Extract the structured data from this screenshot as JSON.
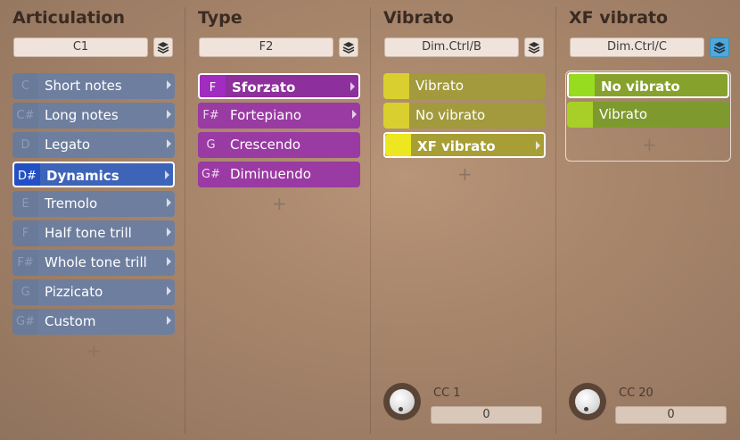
{
  "colors": {
    "articulation_selected": "#2250c4",
    "type_item": "#9a3aa3",
    "vibrato_item": "#d9cf2f",
    "xf_vibrato_item": "#97dc1e",
    "layers_active": "#4fa8d8"
  },
  "columns": {
    "articulation": {
      "title": "Articulation",
      "keyswitch": "C1",
      "layers_icon": "layers-icon",
      "items": [
        {
          "key": "C",
          "label": "Short notes"
        },
        {
          "key": "C#",
          "label": "Long notes"
        },
        {
          "key": "D",
          "label": "Legato"
        },
        {
          "key": "D#",
          "label": "Dynamics",
          "selected": true
        },
        {
          "key": "E",
          "label": "Tremolo"
        },
        {
          "key": "F",
          "label": "Half tone trill"
        },
        {
          "key": "F#",
          "label": "Whole tone trill"
        },
        {
          "key": "G",
          "label": "Pizzicato"
        },
        {
          "key": "G#",
          "label": "Custom"
        }
      ],
      "add_label": "+"
    },
    "type": {
      "title": "Type",
      "keyswitch": "F2",
      "layers_icon": "layers-icon",
      "items": [
        {
          "key": "F",
          "label": "Sforzato",
          "selected": true
        },
        {
          "key": "F#",
          "label": "Fortepiano"
        },
        {
          "key": "G",
          "label": "Crescendo"
        },
        {
          "key": "G#",
          "label": "Diminuendo"
        }
      ],
      "add_label": "+"
    },
    "vibrato": {
      "title": "Vibrato",
      "keyswitch": "Dim.Ctrl/B",
      "layers_icon": "layers-icon",
      "items": [
        {
          "label": "Vibrato"
        },
        {
          "label": "No vibrato"
        },
        {
          "label": "XF vibrato",
          "selected": true
        }
      ],
      "add_label": "+",
      "cc_label": "CC 1",
      "cc_value": "0"
    },
    "xf_vibrato": {
      "title": "XF vibrato",
      "keyswitch": "Dim.Ctrl/C",
      "layers_icon": "layers-icon",
      "layers_active": true,
      "items": [
        {
          "label": "No vibrato",
          "selected": true
        },
        {
          "label": "Vibrato"
        }
      ],
      "add_label": "+",
      "cc_label": "CC 20",
      "cc_value": "0"
    }
  }
}
